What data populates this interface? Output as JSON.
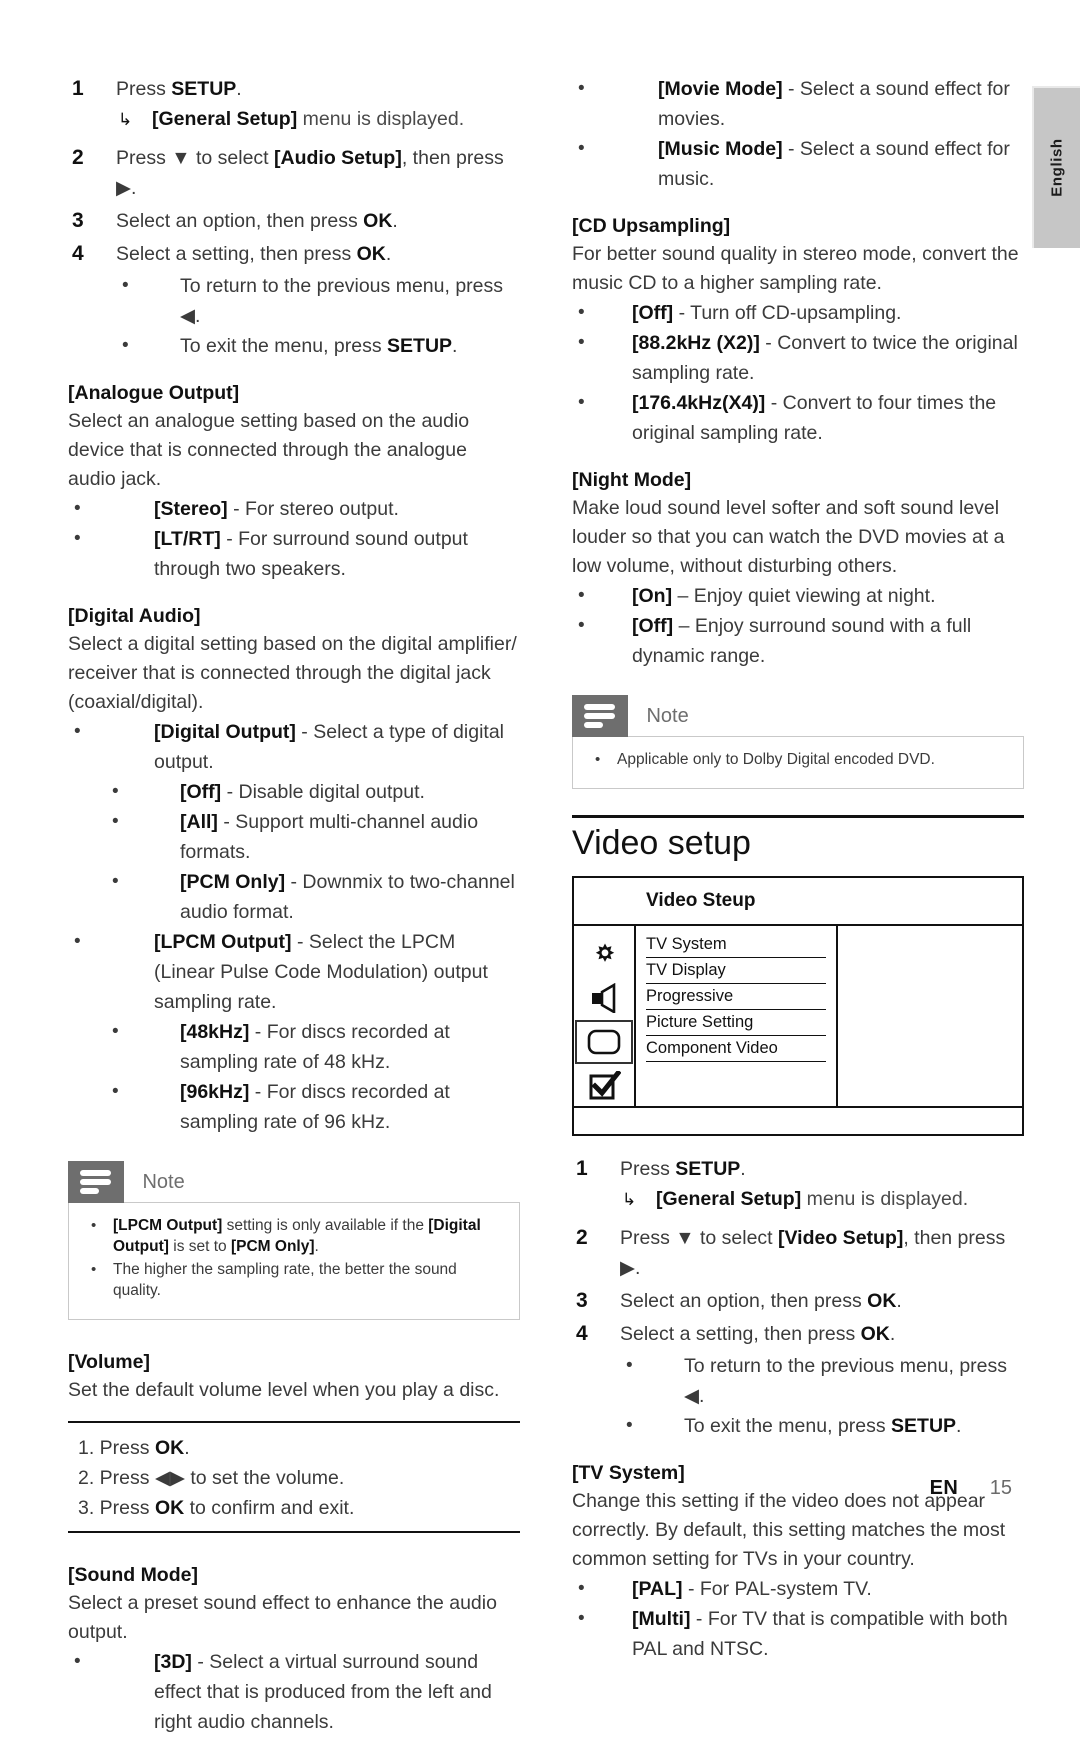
{
  "page": {
    "language_tab": "English",
    "footer_lang": "EN",
    "footer_page": "15"
  },
  "audio_setup": {
    "steps": [
      {
        "num": "1",
        "text_before": "Press ",
        "bold": "SETUP",
        "text_after": "."
      },
      {
        "num": "2",
        "text": "Press ▼ to select [Audio Setup], then press ▶."
      },
      {
        "num": "3",
        "text": "Select an option, then press OK."
      },
      {
        "num": "4",
        "text": "Select a setting, then press OK."
      }
    ],
    "step1_result": "[General Setup] menu is displayed.",
    "step4_bullets": [
      "To return to the previous menu, press ◀.",
      "To exit the menu, press SETUP."
    ]
  },
  "analogue_output": {
    "heading": "[Analogue Output]",
    "body": "Select an analogue setting based on the audio device that is connected through the analogue audio jack.",
    "bullets": [
      {
        "term": "[Stereo]",
        "desc": " - For stereo output."
      },
      {
        "term": "[LT/RT]",
        "desc": " - For surround sound output through two speakers."
      }
    ]
  },
  "digital_audio": {
    "heading": "[Digital Audio]",
    "body": "Select a digital setting based on the digital amplifier/ receiver that is connected through the digital jack (coaxial/digital).",
    "digital_output": {
      "term": "[Digital Output]",
      "desc": " - Select a type of digital output."
    },
    "digital_output_sub": [
      {
        "term": "[Off]",
        "desc": " - Disable digital output."
      },
      {
        "term": "[All]",
        "desc": " - Support multi-channel audio formats."
      },
      {
        "term": "[PCM Only]",
        "desc": " - Downmix to two-channel audio format."
      }
    ],
    "lpcm_output": {
      "term": "[LPCM Output]",
      "desc": " - Select the LPCM (Linear Pulse Code Modulation) output sampling rate."
    },
    "lpcm_output_sub": [
      {
        "term": "[48kHz]",
        "desc": " - For discs recorded at sampling rate of 48 kHz."
      },
      {
        "term": "[96kHz]",
        "desc": " - For discs recorded at sampling rate of 96 kHz."
      }
    ]
  },
  "note_left": {
    "title": "Note",
    "items": [
      {
        "a": "[LPCM Output]",
        "b": " setting is only available if the ",
        "c": "[Digital Output]",
        "d": " is set to ",
        "e": "[PCM Only]",
        "f": "."
      },
      {
        "plain": "The higher the sampling rate, the better the sound quality."
      }
    ]
  },
  "volume": {
    "heading": "[Volume]",
    "body": "Set the default volume level when you play a disc.",
    "procedure": [
      "1. Press OK.",
      "2. Press ◀▶ to set the volume.",
      "3. Press OK to confirm and exit."
    ]
  },
  "sound_mode": {
    "heading": "[Sound Mode]",
    "body": "Select a preset sound effect to enhance the audio output.",
    "bullets": [
      {
        "term": "[3D]",
        "desc": " - Select a virtual surround sound effect that is produced from the left and right audio channels."
      },
      {
        "term": "[Movie Mode]",
        "desc": " - Select a sound effect for movies."
      },
      {
        "term": "[Music Mode]",
        "desc": " - Select a sound effect for music."
      }
    ]
  },
  "cd_upsampling": {
    "heading": "[CD Upsampling]",
    "body": "For better sound quality in stereo mode, convert the music CD to a higher sampling rate.",
    "bullets": [
      {
        "term": "[Off]",
        "desc": " - Turn off CD-upsampling."
      },
      {
        "term": "[88.2kHz (X2)]",
        "desc": " - Convert to twice the original sampling rate."
      },
      {
        "term": "[176.4kHz(X4)]",
        "desc": " - Convert to four times the original sampling rate."
      }
    ]
  },
  "night_mode": {
    "heading": "[Night Mode]",
    "body": "Make loud sound level softer and soft sound level louder so that you can watch the DVD movies at a low volume, without disturbing others.",
    "bullets": [
      {
        "term": "[On]",
        "desc": " – Enjoy quiet viewing at night."
      },
      {
        "term": "[Off]",
        "desc": " – Enjoy surround sound with a full dynamic range."
      }
    ]
  },
  "note_right": {
    "title": "Note",
    "items": [
      {
        "plain": "Applicable only to Dolby Digital encoded DVD."
      }
    ]
  },
  "video_setup": {
    "section_title": "Video setup",
    "screen": {
      "title": "Video Steup",
      "icons": [
        {
          "name": "gear-icon",
          "selected": false
        },
        {
          "name": "speaker-icon",
          "selected": false
        },
        {
          "name": "tv-icon",
          "selected": true
        },
        {
          "name": "checkbox-icon",
          "selected": false
        }
      ],
      "menu_items": [
        "TV System",
        "TV Display",
        "Progressive",
        "Picture Setting",
        "Component Video"
      ]
    },
    "steps": [
      {
        "num": "1",
        "text": "Press SETUP."
      },
      {
        "num": "2",
        "text": "Press ▼ to select [Video Setup], then press ▶."
      },
      {
        "num": "3",
        "text": "Select an option, then press OK."
      },
      {
        "num": "4",
        "text": "Select a setting, then press OK."
      }
    ],
    "step1_result": "[General Setup] menu is displayed.",
    "step4_bullets": [
      "To return to the previous menu, press ◀.",
      "To exit the menu, press SETUP."
    ]
  },
  "tv_system": {
    "heading": "[TV System]",
    "body": "Change this setting if the video does not appear correctly. By default, this setting matches the most common setting for TVs in your country.",
    "bullets": [
      {
        "term": "[PAL]",
        "desc": " - For PAL-system TV."
      },
      {
        "term": "[Multi]",
        "desc": " - For TV that is compatible with both PAL and NTSC."
      }
    ]
  }
}
